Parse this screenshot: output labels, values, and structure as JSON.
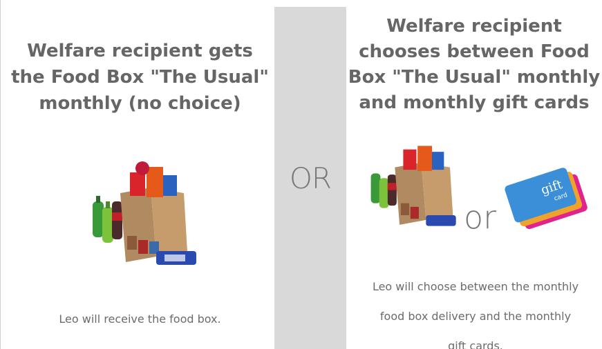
{
  "left": {
    "heading_lines": [
      "Welfare recipient gets",
      "the Food Box \"The Usual\"",
      "monthly (no choice)"
    ],
    "image_alt": "Food box groceries",
    "caption": "Leo will receive the food box."
  },
  "divider": {
    "label": "OR"
  },
  "right": {
    "heading_lines": [
      "Welfare recipient",
      "chooses between Food",
      "Box \"The Usual\" monthly",
      "and monthly gift cards"
    ],
    "or_label": "or",
    "gift_card_text": [
      "gift",
      "card"
    ],
    "caption_lines": [
      "Leo will choose between the monthly",
      "food box delivery and the monthly",
      "gift cards."
    ]
  },
  "colors": {
    "heading": "#666666",
    "divider": "#d9d9d9",
    "card_blue": "#3b8fd9",
    "card_pink": "#e0238f",
    "card_orange": "#f0a22a"
  }
}
